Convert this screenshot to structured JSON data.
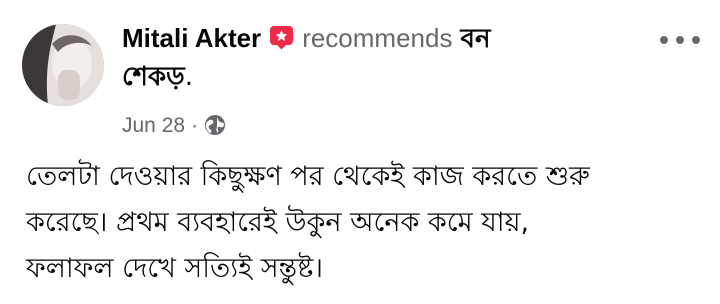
{
  "post": {
    "author": "Mitali Akter",
    "action": "recommends",
    "page_name_line1": "বন",
    "page_name_line2": "শেকড়",
    "page_name_suffix": ".",
    "date": "Jun 28",
    "separator": "·",
    "audience_icon": "globe-icon",
    "recommend_icon": "recommend-tag-icon",
    "more_icon": "more-options-icon",
    "body_lines": [
      "তেলটা দেওয়ার কিছুক্ষণ পর থেকেই কাজ করতে শুরু",
      "করেছে। প্রথম ব্যবহারেই উকুন অনেক কমে যায়,",
      "ফলাফল দেখে সত্যিই সন্তুষ্ট।"
    ]
  },
  "colors": {
    "text_primary": "#050505",
    "text_secondary": "#65676b",
    "recommend_badge": "#f02849",
    "background": "#ffffff"
  }
}
